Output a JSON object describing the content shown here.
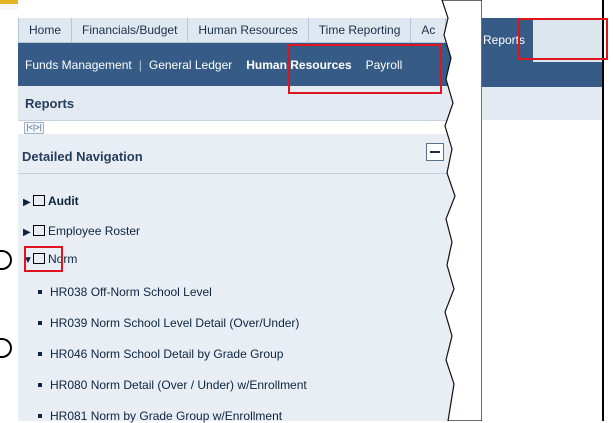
{
  "top_tabs": [
    "Home",
    "Financials/Budget",
    "Human Resources",
    "Time Reporting",
    "Ac"
  ],
  "subnav": [
    "Funds Management",
    "General Ledger",
    "Human Resources",
    "Payroll"
  ],
  "subnav_separator": "|",
  "breadcrumb": "Reports",
  "pager": "|<|>|",
  "panel_title": "Detailed Navigation",
  "tree": [
    {
      "label": "Audit",
      "expanded": false,
      "bold": true
    },
    {
      "label": "Employee Roster",
      "expanded": false,
      "bold": false
    },
    {
      "label": "Norm",
      "expanded": true,
      "bold": false
    }
  ],
  "reports_tab": "Reports",
  "norm_reports": [
    "HR038 Off-Norm School Level",
    "HR039 Norm School Level Detail (Over/Under)",
    "HR046 Norm School Detail by Grade Group",
    "HR080 Norm Detail (Over / Under) w/Enrollment",
    "HR081 Norm by Grade Group w/Enrollment"
  ],
  "colors": {
    "nav_blue": "#355b86",
    "tab_bg": "#dfe8f1",
    "panel_bg": "#e8eef4",
    "highlight_red": "#e0141e"
  },
  "icons": [
    "right-triangle-icon",
    "down-triangle-icon",
    "folder-icon",
    "collapse-minus-icon",
    "bullet-icon"
  ]
}
